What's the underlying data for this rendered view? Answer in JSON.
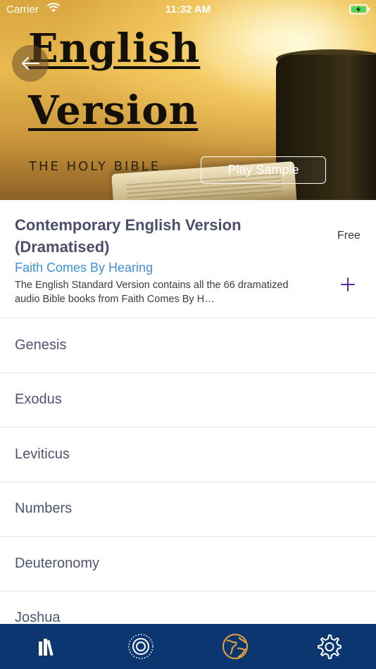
{
  "status_bar": {
    "carrier": "Carrier",
    "time": "11:32 AM",
    "wifi_icon": "wifi-icon",
    "battery_icon": "battery-charging-icon"
  },
  "hero": {
    "cover_lines": [
      "English",
      "Version"
    ],
    "cover_subtitle": "THE HOLY BIBLE",
    "back_icon": "arrow-left-icon",
    "play_sample_label": "Play Sample"
  },
  "bible": {
    "title": "Contemporary English Version (Dramatised)",
    "publisher": "Faith Comes By Hearing",
    "description": "The English Standard Version contains all the 66 dramatized audio Bible books from Faith Comes By H…",
    "price": "Free",
    "add_icon": "plus-icon"
  },
  "books": [
    {
      "name": "Genesis"
    },
    {
      "name": "Exodus"
    },
    {
      "name": "Leviticus"
    },
    {
      "name": "Numbers"
    },
    {
      "name": "Deuteronomy"
    },
    {
      "name": "Joshua"
    }
  ],
  "tabbar": {
    "tabs": [
      {
        "icon": "library-icon"
      },
      {
        "icon": "radio-icon"
      },
      {
        "icon": "globe-icon",
        "active": true
      },
      {
        "icon": "gear-icon"
      }
    ]
  },
  "colors": {
    "tab_bar": "#0b3670",
    "tab_icon": "#ffffff",
    "tab_icon_active": "#f2a23b",
    "publisher": "#3f8fd6",
    "add_icon": "#5b2d9e",
    "title": "#4a4f6a"
  }
}
